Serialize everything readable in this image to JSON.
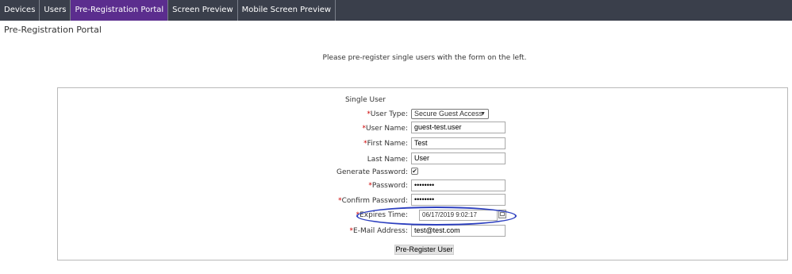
{
  "nav": {
    "tabs": [
      {
        "label": "Devices"
      },
      {
        "label": "Users"
      },
      {
        "label": "Pre-Registration Portal"
      },
      {
        "label": "Screen Preview"
      },
      {
        "label": "Mobile Screen Preview"
      }
    ],
    "active_index": 2
  },
  "page": {
    "title": "Pre-Registration Portal",
    "intro": "Please pre-register single users with the form on the left."
  },
  "form": {
    "title": "Single User",
    "required_marker": "*",
    "fields": {
      "user_type": {
        "label": "User Type:",
        "value": "Secure Guest Access"
      },
      "user_name": {
        "label": "User Name:",
        "value": "guest-test.user"
      },
      "first_name": {
        "label": "First Name:",
        "value": "Test"
      },
      "last_name": {
        "label": "Last Name:",
        "value": "User"
      },
      "generate_password": {
        "label": "Generate Password:",
        "checked": "✔"
      },
      "password": {
        "label": "Password:",
        "value": "••••••••"
      },
      "confirm_password": {
        "label": "Confirm Password:",
        "value": "••••••••"
      },
      "expires_time": {
        "label": "Expires Time:",
        "value": "06/17/2019 9:02:17"
      },
      "email": {
        "label": "E-Mail Address:",
        "value": "test@test.com"
      }
    },
    "submit_label": "Pre-Register User"
  },
  "colors": {
    "navbar": "#3a3f4b",
    "active_tab": "#5b2d8e",
    "required": "#cc0000",
    "annotation_circle": "#2c3fbf"
  }
}
